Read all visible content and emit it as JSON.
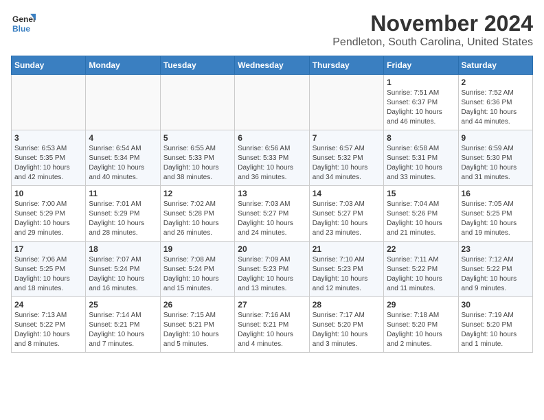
{
  "header": {
    "logo_general": "General",
    "logo_blue": "Blue",
    "month": "November 2024",
    "location": "Pendleton, South Carolina, United States"
  },
  "days_of_week": [
    "Sunday",
    "Monday",
    "Tuesday",
    "Wednesday",
    "Thursday",
    "Friday",
    "Saturday"
  ],
  "weeks": [
    [
      {
        "day": "",
        "info": ""
      },
      {
        "day": "",
        "info": ""
      },
      {
        "day": "",
        "info": ""
      },
      {
        "day": "",
        "info": ""
      },
      {
        "day": "",
        "info": ""
      },
      {
        "day": "1",
        "info": "Sunrise: 7:51 AM\nSunset: 6:37 PM\nDaylight: 10 hours and 46 minutes."
      },
      {
        "day": "2",
        "info": "Sunrise: 7:52 AM\nSunset: 6:36 PM\nDaylight: 10 hours and 44 minutes."
      }
    ],
    [
      {
        "day": "3",
        "info": "Sunrise: 6:53 AM\nSunset: 5:35 PM\nDaylight: 10 hours and 42 minutes."
      },
      {
        "day": "4",
        "info": "Sunrise: 6:54 AM\nSunset: 5:34 PM\nDaylight: 10 hours and 40 minutes."
      },
      {
        "day": "5",
        "info": "Sunrise: 6:55 AM\nSunset: 5:33 PM\nDaylight: 10 hours and 38 minutes."
      },
      {
        "day": "6",
        "info": "Sunrise: 6:56 AM\nSunset: 5:33 PM\nDaylight: 10 hours and 36 minutes."
      },
      {
        "day": "7",
        "info": "Sunrise: 6:57 AM\nSunset: 5:32 PM\nDaylight: 10 hours and 34 minutes."
      },
      {
        "day": "8",
        "info": "Sunrise: 6:58 AM\nSunset: 5:31 PM\nDaylight: 10 hours and 33 minutes."
      },
      {
        "day": "9",
        "info": "Sunrise: 6:59 AM\nSunset: 5:30 PM\nDaylight: 10 hours and 31 minutes."
      }
    ],
    [
      {
        "day": "10",
        "info": "Sunrise: 7:00 AM\nSunset: 5:29 PM\nDaylight: 10 hours and 29 minutes."
      },
      {
        "day": "11",
        "info": "Sunrise: 7:01 AM\nSunset: 5:29 PM\nDaylight: 10 hours and 28 minutes."
      },
      {
        "day": "12",
        "info": "Sunrise: 7:02 AM\nSunset: 5:28 PM\nDaylight: 10 hours and 26 minutes."
      },
      {
        "day": "13",
        "info": "Sunrise: 7:03 AM\nSunset: 5:27 PM\nDaylight: 10 hours and 24 minutes."
      },
      {
        "day": "14",
        "info": "Sunrise: 7:03 AM\nSunset: 5:27 PM\nDaylight: 10 hours and 23 minutes."
      },
      {
        "day": "15",
        "info": "Sunrise: 7:04 AM\nSunset: 5:26 PM\nDaylight: 10 hours and 21 minutes."
      },
      {
        "day": "16",
        "info": "Sunrise: 7:05 AM\nSunset: 5:25 PM\nDaylight: 10 hours and 19 minutes."
      }
    ],
    [
      {
        "day": "17",
        "info": "Sunrise: 7:06 AM\nSunset: 5:25 PM\nDaylight: 10 hours and 18 minutes."
      },
      {
        "day": "18",
        "info": "Sunrise: 7:07 AM\nSunset: 5:24 PM\nDaylight: 10 hours and 16 minutes."
      },
      {
        "day": "19",
        "info": "Sunrise: 7:08 AM\nSunset: 5:24 PM\nDaylight: 10 hours and 15 minutes."
      },
      {
        "day": "20",
        "info": "Sunrise: 7:09 AM\nSunset: 5:23 PM\nDaylight: 10 hours and 13 minutes."
      },
      {
        "day": "21",
        "info": "Sunrise: 7:10 AM\nSunset: 5:23 PM\nDaylight: 10 hours and 12 minutes."
      },
      {
        "day": "22",
        "info": "Sunrise: 7:11 AM\nSunset: 5:22 PM\nDaylight: 10 hours and 11 minutes."
      },
      {
        "day": "23",
        "info": "Sunrise: 7:12 AM\nSunset: 5:22 PM\nDaylight: 10 hours and 9 minutes."
      }
    ],
    [
      {
        "day": "24",
        "info": "Sunrise: 7:13 AM\nSunset: 5:22 PM\nDaylight: 10 hours and 8 minutes."
      },
      {
        "day": "25",
        "info": "Sunrise: 7:14 AM\nSunset: 5:21 PM\nDaylight: 10 hours and 7 minutes."
      },
      {
        "day": "26",
        "info": "Sunrise: 7:15 AM\nSunset: 5:21 PM\nDaylight: 10 hours and 5 minutes."
      },
      {
        "day": "27",
        "info": "Sunrise: 7:16 AM\nSunset: 5:21 PM\nDaylight: 10 hours and 4 minutes."
      },
      {
        "day": "28",
        "info": "Sunrise: 7:17 AM\nSunset: 5:20 PM\nDaylight: 10 hours and 3 minutes."
      },
      {
        "day": "29",
        "info": "Sunrise: 7:18 AM\nSunset: 5:20 PM\nDaylight: 10 hours and 2 minutes."
      },
      {
        "day": "30",
        "info": "Sunrise: 7:19 AM\nSunset: 5:20 PM\nDaylight: 10 hours and 1 minute."
      }
    ]
  ]
}
